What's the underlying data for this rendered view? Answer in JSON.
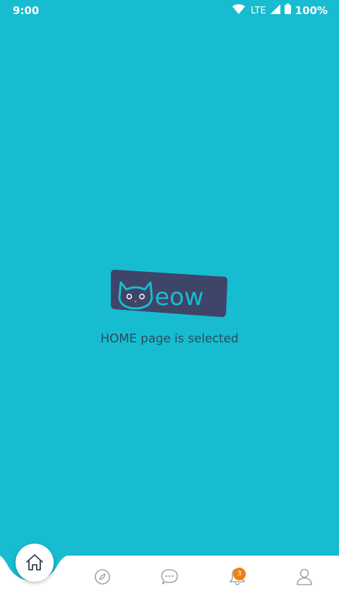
{
  "status_bar": {
    "time": "9:00",
    "network": "LTE",
    "battery": "100%",
    "icons": [
      "wifi-icon",
      "signal-icon",
      "battery-icon"
    ]
  },
  "main": {
    "logo_text": "eow",
    "selected_text": "HOME page is selected"
  },
  "nav": {
    "items": [
      {
        "name": "home",
        "icon": "home-icon",
        "active": true
      },
      {
        "name": "explore",
        "icon": "compass-icon"
      },
      {
        "name": "messages",
        "icon": "chat-bubble-icon"
      },
      {
        "name": "notifications",
        "icon": "bell-icon",
        "badge": "3"
      },
      {
        "name": "profile",
        "icon": "user-icon"
      }
    ]
  },
  "colors": {
    "background": "#17BCD0",
    "logo_background": "#3E4569",
    "accent": "#17BCD0",
    "badge": "#F27D12",
    "nav_icon": "#9AA7AE"
  }
}
